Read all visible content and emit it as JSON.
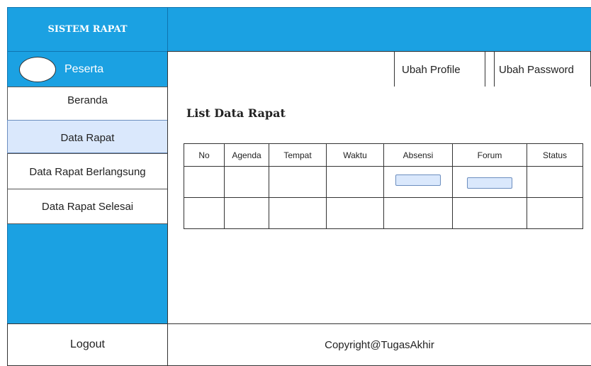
{
  "header": {
    "brand": "SISTEM RAPAT"
  },
  "user": {
    "role": "Peserta"
  },
  "topnav": {
    "profile": "Ubah Profile",
    "password": "Ubah Password"
  },
  "sidebar": {
    "items": [
      {
        "label": "Beranda"
      },
      {
        "label": "Data Rapat"
      },
      {
        "label": "Data Rapat Berlangsung"
      },
      {
        "label": "Data Rapat Selesai"
      }
    ],
    "logout": "Logout"
  },
  "main": {
    "title": "List Data Rapat",
    "columns": [
      "No",
      "Agenda",
      "Tempat",
      "Waktu",
      "Absensi",
      "Forum",
      "Status"
    ]
  },
  "footer": {
    "copyright": "Copyright@TugasAkhir"
  },
  "colors": {
    "accent": "#1ba1e2",
    "active_item": "#dae8fc"
  }
}
